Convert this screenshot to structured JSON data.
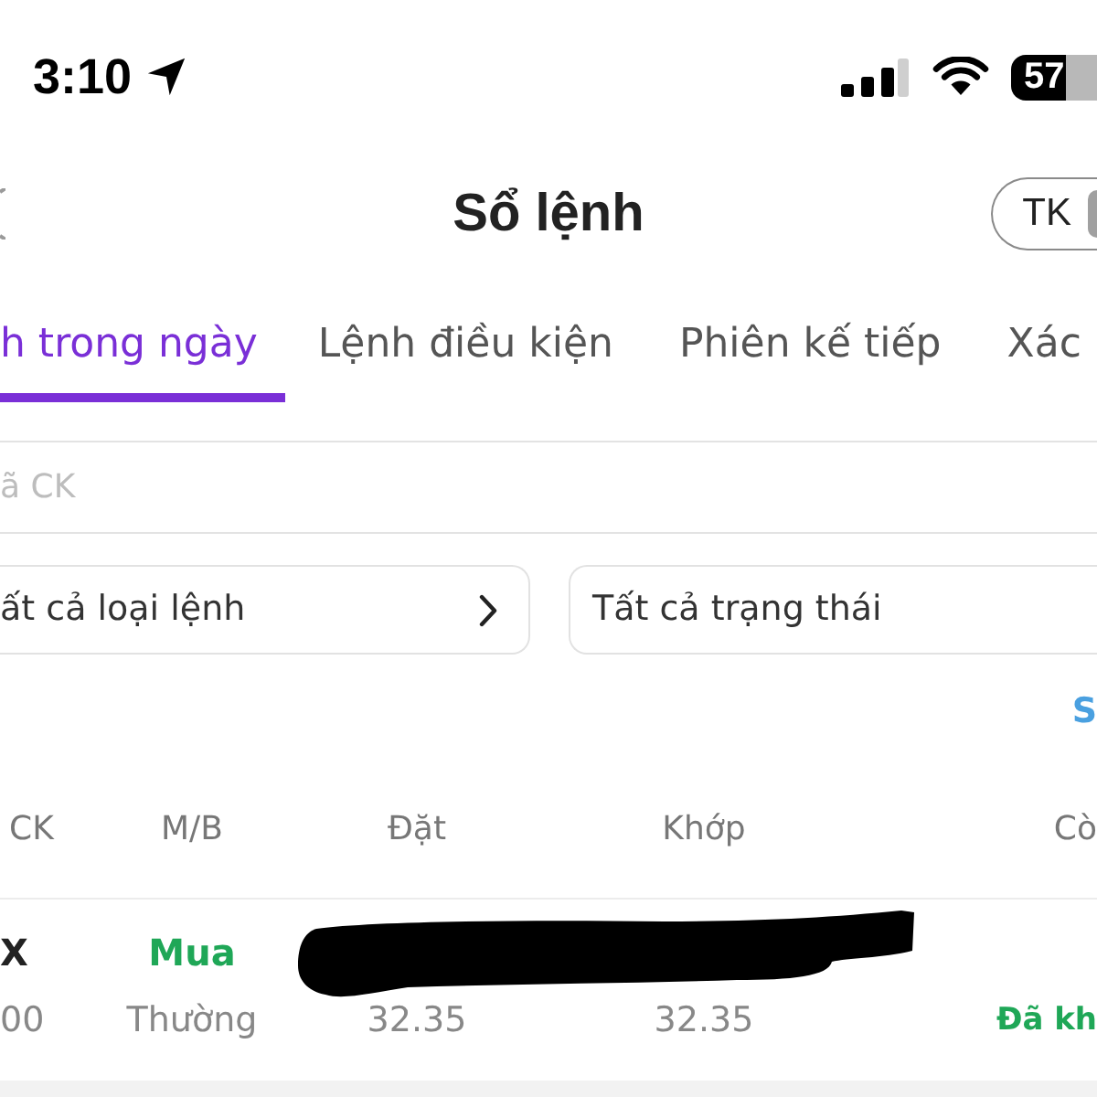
{
  "status_bar": {
    "time": "3:10",
    "battery": "57"
  },
  "header": {
    "title": "Sổ lệnh",
    "account_button": "TK"
  },
  "tabs": [
    {
      "label": "h trong ngày",
      "selected": true
    },
    {
      "label": "Lệnh điều kiện",
      "selected": false
    },
    {
      "label": "Phiên kế tiếp",
      "selected": false
    },
    {
      "label": "Xác",
      "selected": false
    }
  ],
  "search": {
    "placeholder": "ã CK"
  },
  "filters": [
    {
      "label": "ất cả loại lệnh",
      "chevron": true
    },
    {
      "label": "Tất cả trạng thái",
      "chevron": false
    }
  ],
  "link": "S",
  "table": {
    "columns": [
      "CK",
      "M/B",
      "Đặt",
      "Khớp",
      "Cò"
    ],
    "rows": [
      {
        "redacted": true,
        "cells": [
          [
            {
              "text": "X"
            },
            {
              "text": "00"
            }
          ],
          [
            {
              "text": "Mua",
              "color": "#1fa757"
            },
            {
              "text": "Thường"
            }
          ],
          [
            null,
            {
              "text": "32.35"
            }
          ],
          [
            null,
            {
              "text": "32.35"
            }
          ],
          [
            null,
            {
              "text": "Đã kh",
              "color": "#1fa757"
            }
          ]
        ]
      }
    ]
  }
}
